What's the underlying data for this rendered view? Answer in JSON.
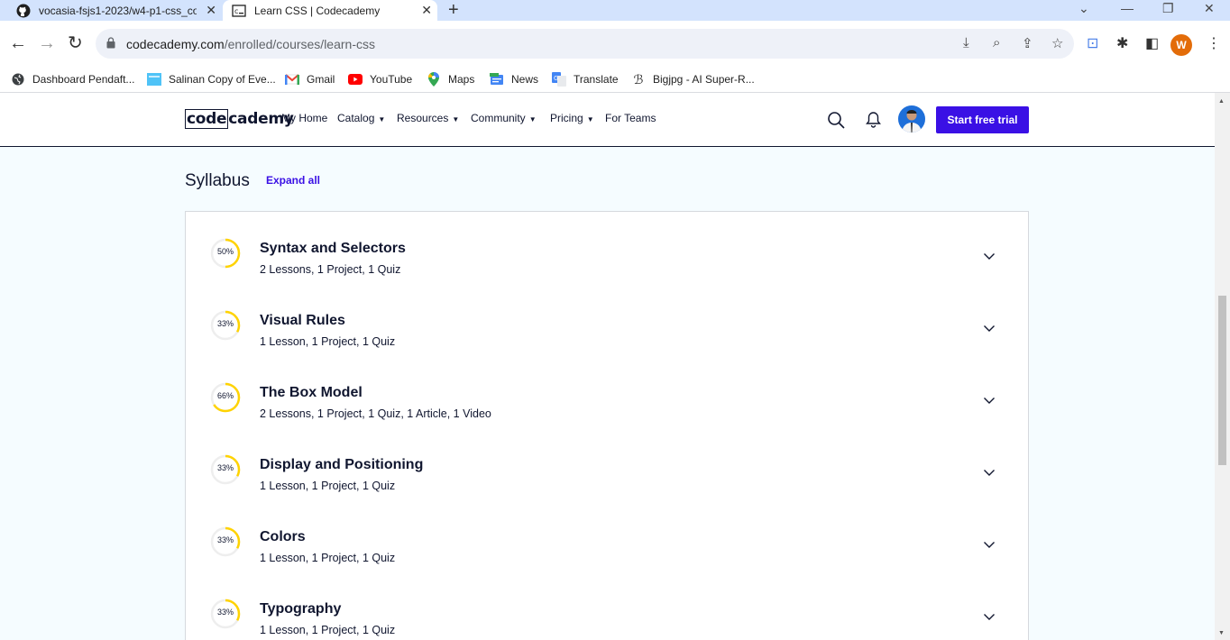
{
  "browser": {
    "tabs": [
      {
        "title": "vocasia-fsjs1-2023/w4-p1-css_co",
        "icon": "github-icon"
      },
      {
        "title": "Learn CSS | Codecademy",
        "icon": "codecademy-icon"
      }
    ],
    "url_domain": "codecademy.com",
    "url_path": "/enrolled/courses/learn-css",
    "profile_initial": "W",
    "bookmarks": [
      {
        "label": "Dashboard Pendaft...",
        "icon": "globe-icon"
      },
      {
        "label": "Salinan Copy of Eve...",
        "icon": "sheet-icon"
      },
      {
        "label": "Gmail",
        "icon": "gmail-icon"
      },
      {
        "label": "YouTube",
        "icon": "youtube-icon"
      },
      {
        "label": "Maps",
        "icon": "maps-icon"
      },
      {
        "label": "News",
        "icon": "news-icon"
      },
      {
        "label": "Translate",
        "icon": "translate-icon"
      },
      {
        "label": "Bigjpg - AI Super-R...",
        "icon": "bigjpg-icon"
      }
    ]
  },
  "site": {
    "logo_left": "code",
    "logo_right": "cademy",
    "nav": [
      {
        "label": "My Home",
        "dropdown": false
      },
      {
        "label": "Catalog",
        "dropdown": true
      },
      {
        "label": "Resources",
        "dropdown": true
      },
      {
        "label": "Community",
        "dropdown": true
      },
      {
        "label": "Pricing",
        "dropdown": true
      },
      {
        "label": "For Teams",
        "dropdown": false
      }
    ],
    "cta_label": "Start free trial",
    "accent_color": "#3a10e5",
    "progress_color": "#ffd300"
  },
  "syllabus": {
    "title": "Syllabus",
    "expand_label": "Expand all",
    "modules": [
      {
        "title": "Syntax and Selectors",
        "details": "2 Lessons, 1 Project, 1 Quiz",
        "progress_label": "50%",
        "progress": 0.5
      },
      {
        "title": "Visual Rules",
        "details": "1 Lesson, 1 Project, 1 Quiz",
        "progress_label": "33%",
        "progress": 0.33
      },
      {
        "title": "The Box Model",
        "details": "2 Lessons, 1 Project, 1 Quiz, 1 Article, 1 Video",
        "progress_label": "66%",
        "progress": 0.66
      },
      {
        "title": "Display and Positioning",
        "details": "1 Lesson, 1 Project, 1 Quiz",
        "progress_label": "33%",
        "progress": 0.33
      },
      {
        "title": "Colors",
        "details": "1 Lesson, 1 Project, 1 Quiz",
        "progress_label": "33%",
        "progress": 0.33
      },
      {
        "title": "Typography",
        "details": "1 Lesson, 1 Project, 1 Quiz",
        "progress_label": "33%",
        "progress": 0.33
      }
    ]
  }
}
